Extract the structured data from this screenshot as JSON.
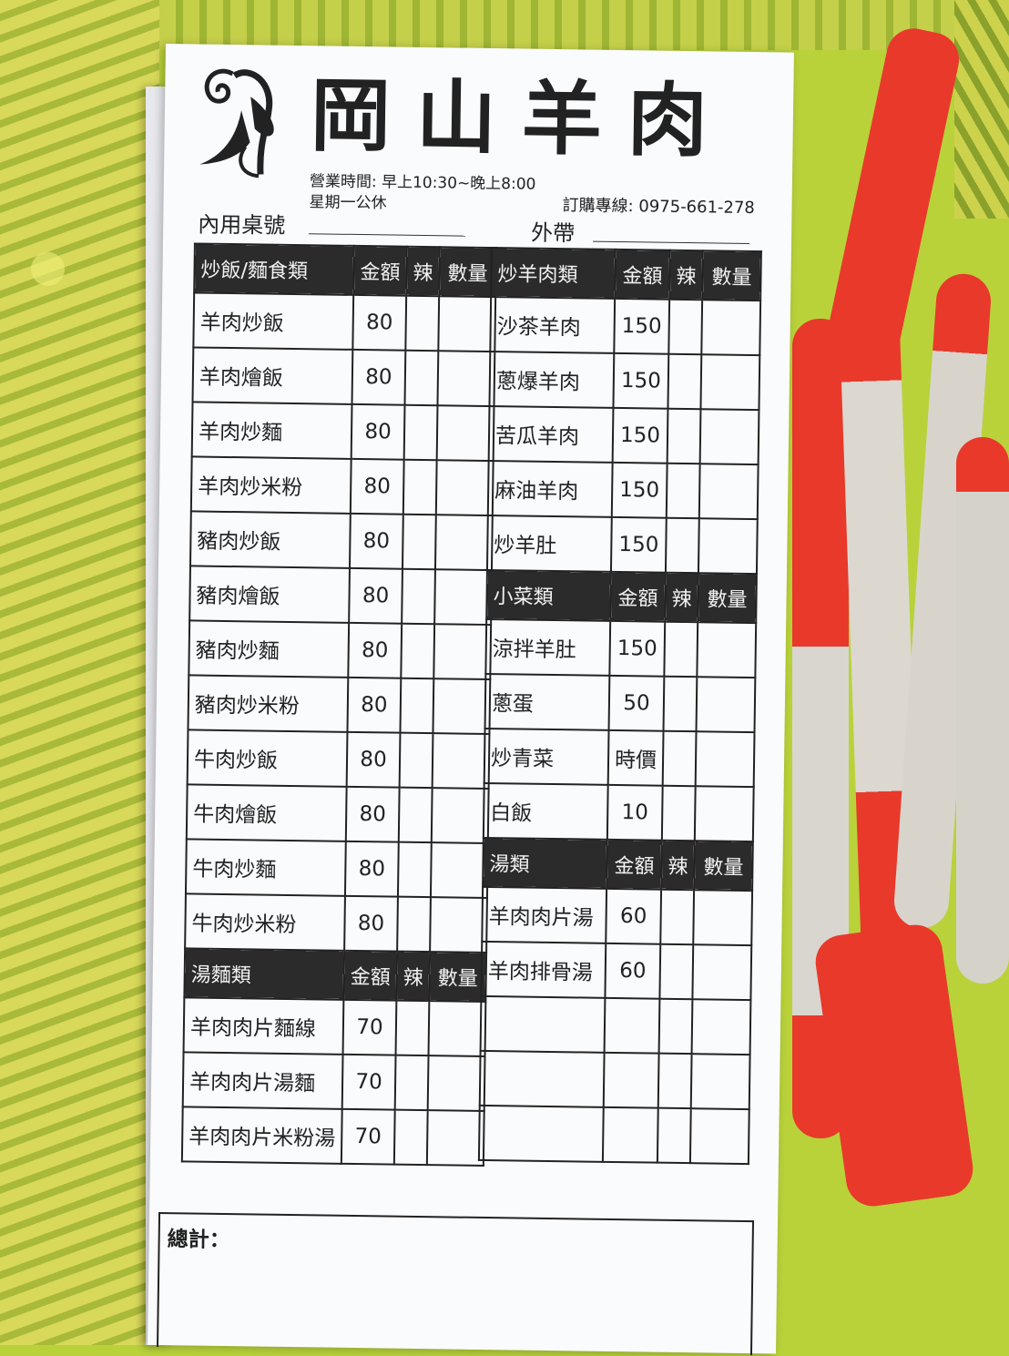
{
  "header": {
    "title": "岡山羊肉",
    "hours": "營業時間: 早上10:30~晚上8:00",
    "closed": "星期一公休",
    "phone": "訂購專線: 0975-661-278",
    "dine_in_label": "內用桌號",
    "takeout_label": "外帶"
  },
  "columns": {
    "price": "金額",
    "spicy": "辣",
    "qty": "數量"
  },
  "left_sections": [
    {
      "name": "炒飯/麵食類",
      "items": [
        {
          "name": "羊肉炒飯",
          "price": "80"
        },
        {
          "name": "羊肉燴飯",
          "price": "80"
        },
        {
          "name": "羊肉炒麵",
          "price": "80"
        },
        {
          "name": "羊肉炒米粉",
          "price": "80"
        },
        {
          "name": "豬肉炒飯",
          "price": "80"
        },
        {
          "name": "豬肉燴飯",
          "price": "80"
        },
        {
          "name": "豬肉炒麵",
          "price": "80"
        },
        {
          "name": "豬肉炒米粉",
          "price": "80"
        },
        {
          "name": "牛肉炒飯",
          "price": "80"
        },
        {
          "name": "牛肉燴飯",
          "price": "80"
        },
        {
          "name": "牛肉炒麵",
          "price": "80"
        },
        {
          "name": "牛肉炒米粉",
          "price": "80"
        }
      ]
    },
    {
      "name": "湯麵類",
      "items": [
        {
          "name": "羊肉肉片麵線",
          "price": "70"
        },
        {
          "name": "羊肉肉片湯麵",
          "price": "70"
        },
        {
          "name": "羊肉肉片米粉湯",
          "price": "70"
        }
      ]
    }
  ],
  "right_sections": [
    {
      "name": "炒羊肉類",
      "items": [
        {
          "name": "沙茶羊肉",
          "price": "150"
        },
        {
          "name": "蔥爆羊肉",
          "price": "150"
        },
        {
          "name": "苦瓜羊肉",
          "price": "150"
        },
        {
          "name": "麻油羊肉",
          "price": "150"
        },
        {
          "name": "炒羊肚",
          "price": "150"
        }
      ]
    },
    {
      "name": "小菜類",
      "items": [
        {
          "name": "涼拌羊肚",
          "price": "150"
        },
        {
          "name": "蔥蛋",
          "price": "50"
        },
        {
          "name": "炒青菜",
          "price": "時價"
        },
        {
          "name": "白飯",
          "price": "10"
        }
      ]
    },
    {
      "name": "湯類",
      "items": [
        {
          "name": "羊肉肉片湯",
          "price": "60"
        },
        {
          "name": "羊肉排骨湯",
          "price": "60"
        },
        {
          "name": "",
          "price": ""
        },
        {
          "name": "",
          "price": ""
        },
        {
          "name": "",
          "price": ""
        }
      ]
    }
  ],
  "total_label": "總計："
}
